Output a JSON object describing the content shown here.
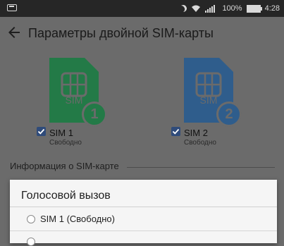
{
  "status_bar": {
    "battery": "100%",
    "time": "4:28"
  },
  "header": {
    "title": "Параметры двойной SIM-карты"
  },
  "sims": [
    {
      "badge_text": "SIM",
      "number": "1",
      "name": "SIM 1",
      "status": "Свободно",
      "checked": true,
      "color": "#237a47"
    },
    {
      "badge_text": "SIM",
      "number": "2",
      "name": "SIM 2",
      "status": "Свободно",
      "checked": true,
      "color": "#2f5d8c"
    }
  ],
  "section": {
    "title": "Информация о SIM-карте"
  },
  "dialog": {
    "title": "Голосовой вызов",
    "options": [
      "SIM 1 (Свободно)"
    ]
  },
  "background_glyphs": [
    "И",
    "И"
  ]
}
